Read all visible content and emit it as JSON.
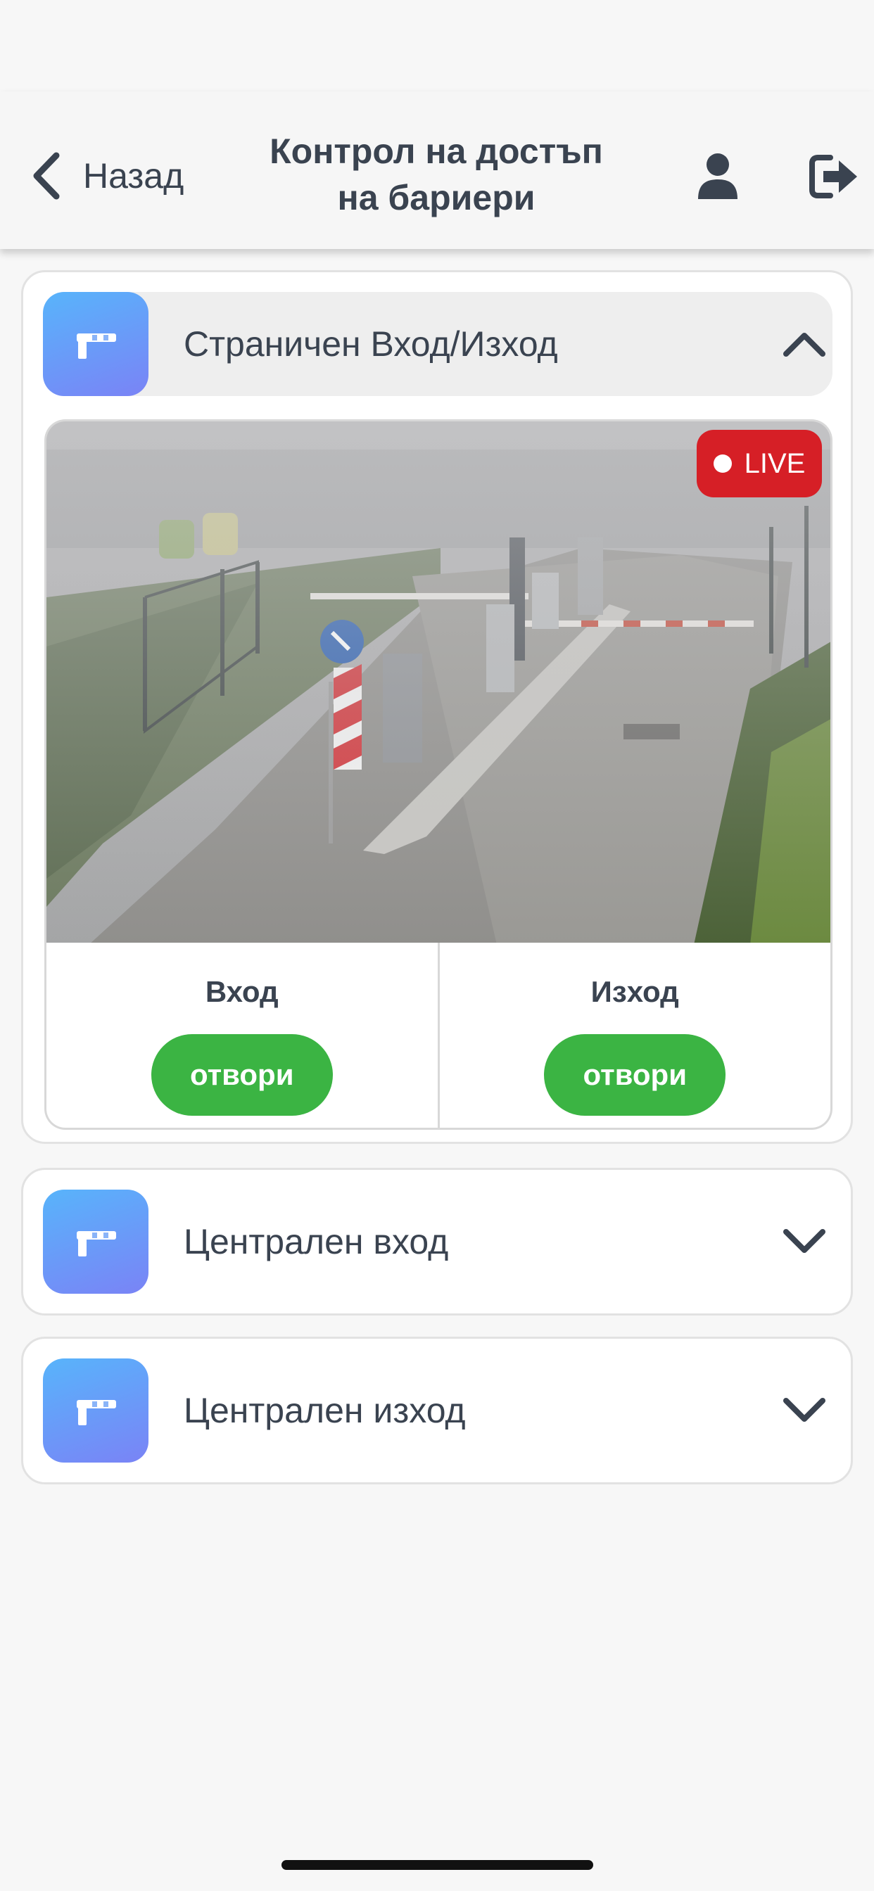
{
  "header": {
    "back_label": "Назад",
    "title_line1": "Контрол на достъп",
    "title_line2": "на бариери",
    "icons": {
      "back": "chevron-left-icon",
      "user": "user-icon",
      "logout": "logout-icon"
    }
  },
  "gates": [
    {
      "name": "Страничен Вход/Изход",
      "expanded": true,
      "icon": "barrier-gate-icon"
    },
    {
      "name": "Централен вход",
      "expanded": false,
      "icon": "barrier-gate-icon"
    },
    {
      "name": "Централен изход",
      "expanded": false,
      "icon": "barrier-gate-icon"
    }
  ],
  "camera": {
    "live_label": "LIVE"
  },
  "controls": {
    "entry_label": "Вход",
    "exit_label": "Изход",
    "open_label": "отвори"
  },
  "colors": {
    "accent_green": "#3bb443",
    "live_red": "#d61f26",
    "icon_gradient_start": "#58b4fb",
    "icon_gradient_end": "#7a83f6",
    "text": "#3a4350"
  }
}
